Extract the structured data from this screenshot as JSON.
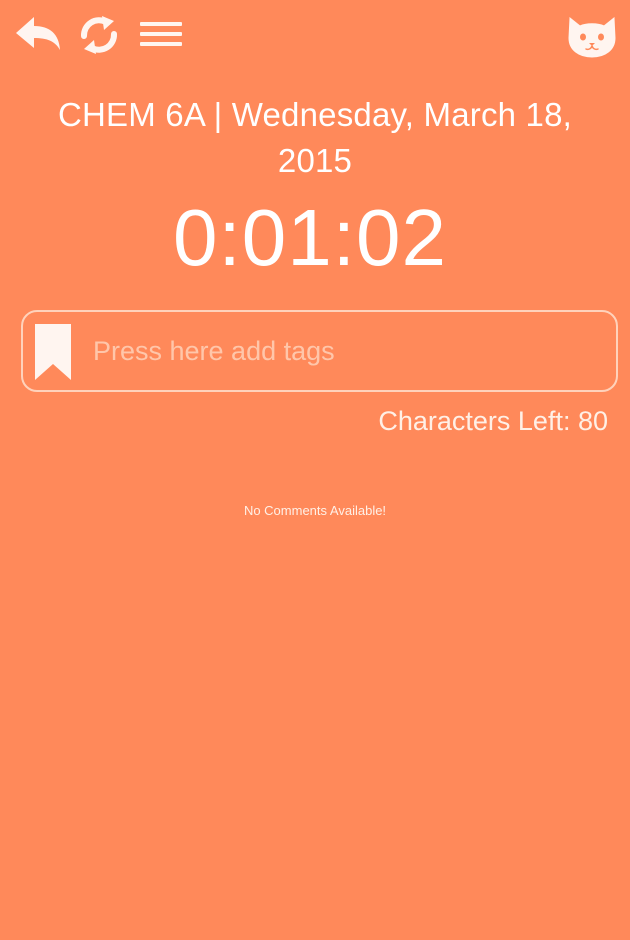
{
  "toolbar": {
    "back_icon": "reply-arrow-icon",
    "refresh_icon": "refresh-icon",
    "menu_icon": "hamburger-menu-icon",
    "avatar_icon": "cat-face-icon"
  },
  "header": {
    "course": "CHEM 6A",
    "separator": " | ",
    "date": "Wednesday, March 18, 2015"
  },
  "timer": {
    "value": "0:01:02"
  },
  "tags": {
    "icon": "bookmark-icon",
    "value": "",
    "placeholder": "Press here add tags"
  },
  "characters_left": {
    "label": "Characters Left: ",
    "count": "80"
  },
  "comments": {
    "empty_message": "No Comments Available!"
  },
  "colors": {
    "background": "#FF895A",
    "foreground": "#FFFFFF",
    "icon_fill": "#FFF5F0"
  }
}
